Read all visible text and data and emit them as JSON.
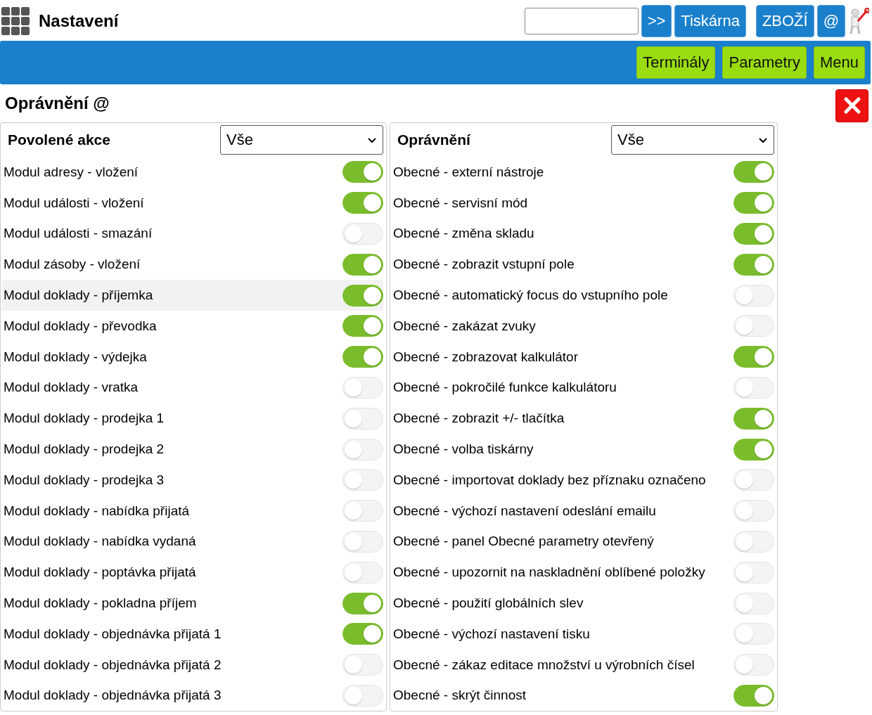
{
  "header": {
    "title": "Nastavení",
    "go_button": ">>",
    "buttons": [
      "Tiskárna",
      "ZBOŽÍ",
      "@"
    ]
  },
  "nav": {
    "buttons": [
      "Terminály",
      "Parametry",
      "Menu"
    ]
  },
  "section": {
    "title": "Oprávnění @"
  },
  "panels": [
    {
      "title": "Povolené akce",
      "filter": "Vše",
      "items": [
        {
          "label": "Modul adresy - vložení",
          "on": true,
          "highlighted": false
        },
        {
          "label": "Modul události - vložení",
          "on": true,
          "highlighted": false
        },
        {
          "label": "Modul události - smazání",
          "on": false,
          "highlighted": false
        },
        {
          "label": "Modul zásoby - vložení",
          "on": true,
          "highlighted": false
        },
        {
          "label": "Modul doklady - příjemka",
          "on": true,
          "highlighted": true
        },
        {
          "label": "Modul doklady - převodka",
          "on": true,
          "highlighted": false
        },
        {
          "label": "Modul doklady - výdejka",
          "on": true,
          "highlighted": false
        },
        {
          "label": "Modul doklady - vratka",
          "on": false,
          "highlighted": false
        },
        {
          "label": "Modul doklady - prodejka 1",
          "on": false,
          "highlighted": false
        },
        {
          "label": "Modul doklady - prodejka 2",
          "on": false,
          "highlighted": false
        },
        {
          "label": "Modul doklady - prodejka 3",
          "on": false,
          "highlighted": false
        },
        {
          "label": "Modul doklady - nabídka přijatá",
          "on": false,
          "highlighted": false
        },
        {
          "label": "Modul doklady - nabídka vydaná",
          "on": false,
          "highlighted": false
        },
        {
          "label": "Modul doklady - poptávka přijatá",
          "on": false,
          "highlighted": false
        },
        {
          "label": "Modul doklady - pokladna příjem",
          "on": true,
          "highlighted": false
        },
        {
          "label": "Modul doklady - objednávka přijatá 1",
          "on": true,
          "highlighted": false
        },
        {
          "label": "Modul doklady - objednávka přijatá 2",
          "on": false,
          "highlighted": false
        },
        {
          "label": "Modul doklady - objednávka přijatá 3",
          "on": false,
          "highlighted": false
        }
      ]
    },
    {
      "title": "Oprávnění",
      "filter": "Vše",
      "items": [
        {
          "label": "Obecné - externí nástroje",
          "on": true,
          "highlighted": false
        },
        {
          "label": "Obecné - servisní mód",
          "on": true,
          "highlighted": false
        },
        {
          "label": "Obecné - změna skladu",
          "on": true,
          "highlighted": false
        },
        {
          "label": "Obecné - zobrazit vstupní pole",
          "on": true,
          "highlighted": false
        },
        {
          "label": "Obecné - automatický focus do vstupního pole",
          "on": false,
          "highlighted": false
        },
        {
          "label": "Obecné - zakázat zvuky",
          "on": false,
          "highlighted": false
        },
        {
          "label": "Obecné - zobrazovat kalkulátor",
          "on": true,
          "highlighted": false
        },
        {
          "label": "Obecné - pokročilé funkce kalkulátoru",
          "on": false,
          "highlighted": false
        },
        {
          "label": "Obecné - zobrazit +/- tlačítka",
          "on": true,
          "highlighted": false
        },
        {
          "label": "Obecné - volba tiskárny",
          "on": true,
          "highlighted": false
        },
        {
          "label": "Obecné - importovat doklady bez příznaku označeno",
          "on": false,
          "highlighted": false
        },
        {
          "label": "Obecné - výchozí nastavení odeslání emailu",
          "on": false,
          "highlighted": false
        },
        {
          "label": "Obecné - panel Obecné parametry otevřený",
          "on": false,
          "highlighted": false
        },
        {
          "label": "Obecné - upozornit na naskladnění oblíbené položky",
          "on": false,
          "highlighted": false
        },
        {
          "label": "Obecné - použití globálních slev",
          "on": false,
          "highlighted": false
        },
        {
          "label": "Obecné - výchozí nastavení tisku",
          "on": false,
          "highlighted": false
        },
        {
          "label": "Obecné - zákaz editace množství u výrobních čísel",
          "on": false,
          "highlighted": false
        },
        {
          "label": "Obecné - skrýt činnost",
          "on": true,
          "highlighted": false
        }
      ]
    }
  ]
}
